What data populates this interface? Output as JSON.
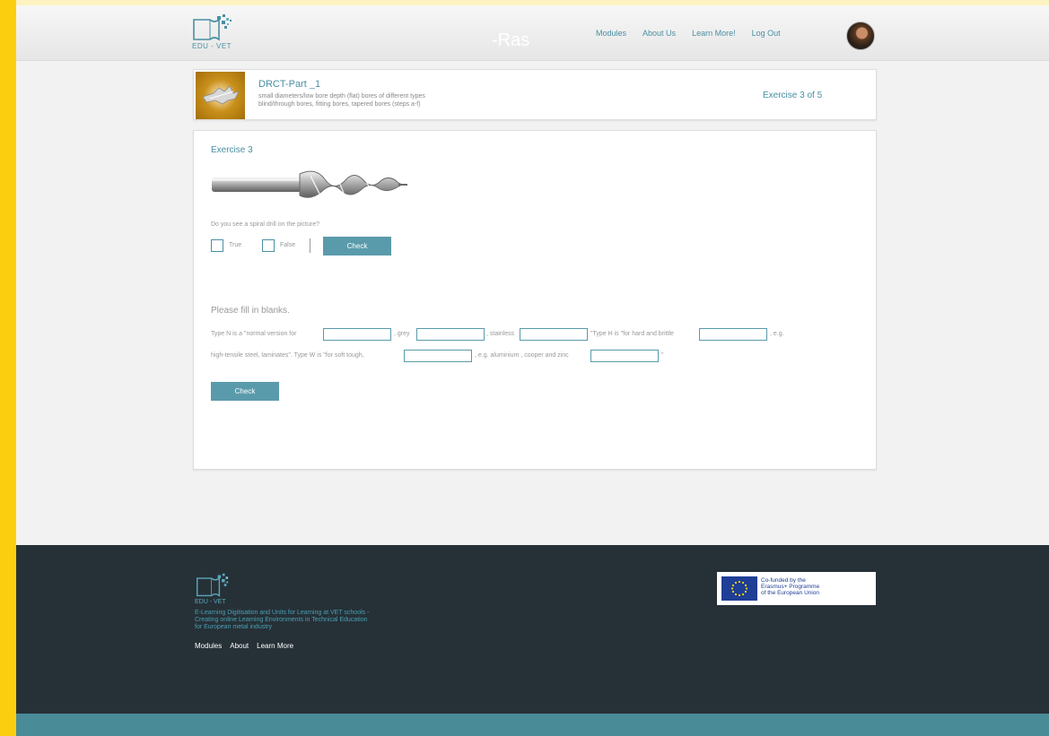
{
  "header": {
    "logo_text": "EDU - VET",
    "user_label": "-Ras",
    "nav": [
      "Modules",
      "About Us",
      "Learn More!",
      "Log Out"
    ]
  },
  "module": {
    "title": "DRCT-Part _1",
    "description_line1": "small diameters/low bore depth (flat) bores of different types",
    "description_line2": "blind/through bores, fitting bores, tapered bores (steps a-f)",
    "exercise_counter": "Exercise 3 of 5"
  },
  "exercise": {
    "title": "Exercise 3",
    "question": "Do you see a spiral drill on the picture?",
    "true_label": "True",
    "false_label": "False",
    "check_label": "Check"
  },
  "fill": {
    "title": "Please fill in blanks.",
    "line1": [
      "Type N is a \"normal version for",
      ", grey",
      ", stainless",
      "\"Type H is \"for hard and brittle",
      ", e.g."
    ],
    "line2": [
      "high-tensile steel, laminates\". Type W is \"for soft tough,",
      ", e.g. aluminium , cooper and zinc",
      "\""
    ],
    "check_label": "Check"
  },
  "footer": {
    "logo_text": "EDU - VET",
    "desc_line1": "E-Learning Digitisation and Units for Learning at VET schools -",
    "desc_line2": "Creating online Learning Environments in Technical Education",
    "desc_line3": "for European metal industry",
    "nav": [
      "Modules",
      "About",
      "Learn More"
    ],
    "eu_line1": "Co-funded by the",
    "eu_line2": "Erasmus+ Programme",
    "eu_line3": "of the European Union"
  },
  "colors": {
    "accent": "#4a8fa3",
    "button": "#5a9bab",
    "footer_bg": "#263137",
    "bottom_band": "#4a8b98",
    "side_bar": "#fbcf10"
  }
}
